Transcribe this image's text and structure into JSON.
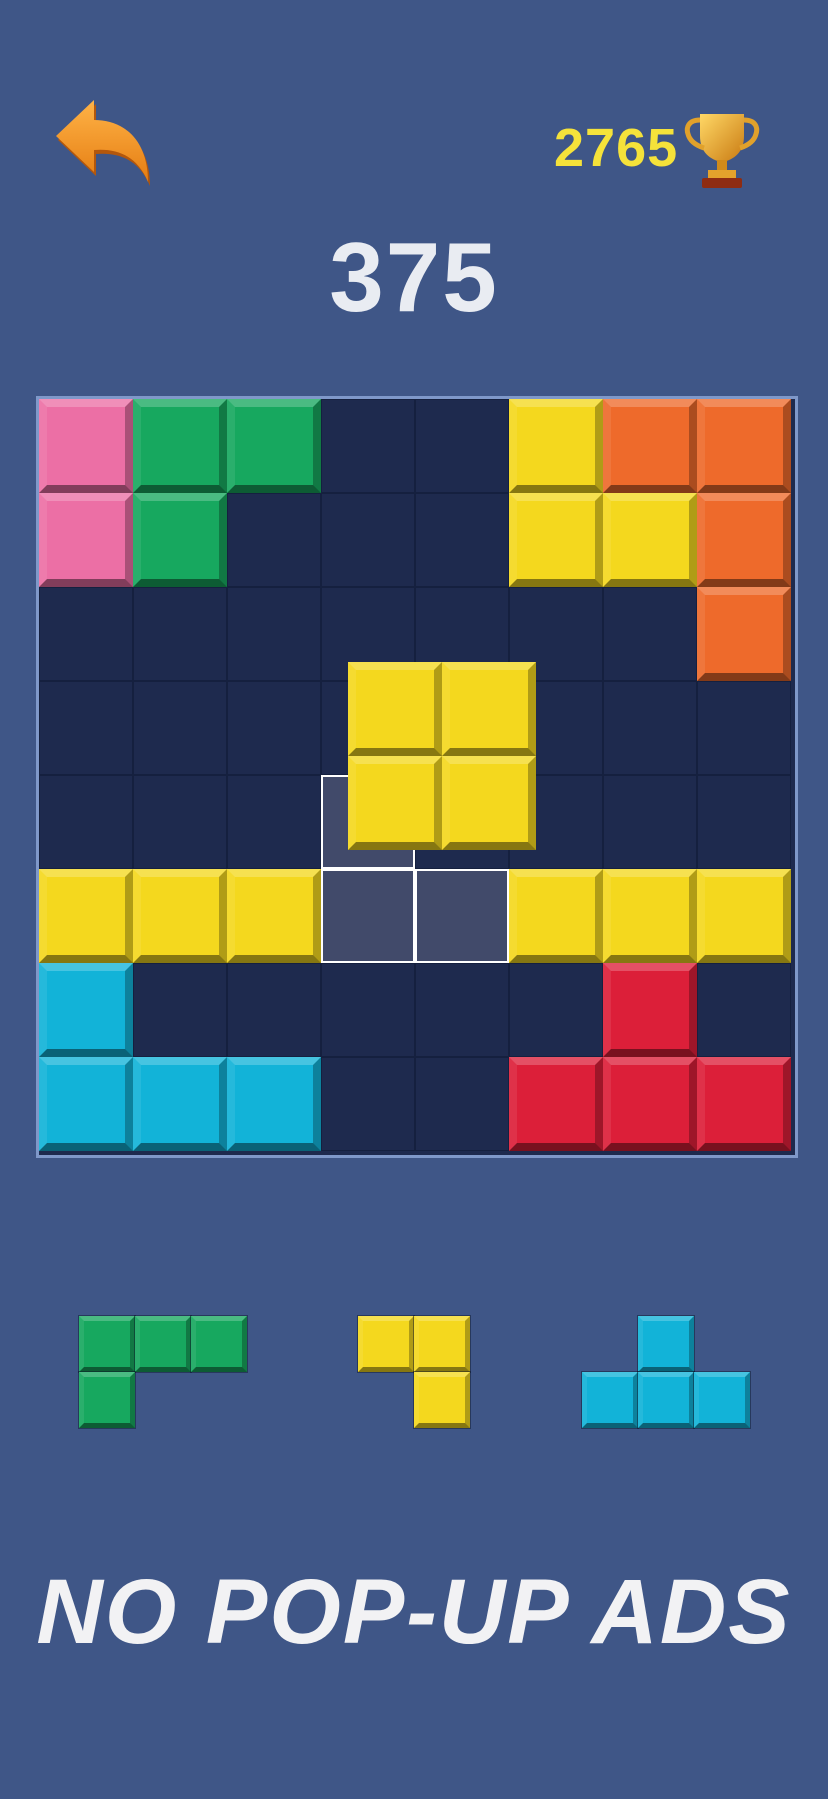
{
  "header": {
    "back_icon": "back-arrow-icon",
    "best_score": "2765",
    "best_icon": "trophy-icon",
    "score": "375"
  },
  "colors": {
    "background": "#3f5687",
    "board": "#1e2a4e",
    "pink": "#ec6fa5",
    "green": "#17a85f",
    "yellow": "#f4d81e",
    "orange": "#ee6a2b",
    "cyan": "#12b3d8",
    "red": "#dc1f39",
    "highlight": "#414a6a"
  },
  "board": {
    "rows": 8,
    "cols": 8,
    "cells": [
      [
        "pink",
        "green",
        "green",
        "",
        "",
        "yellow",
        "orange",
        "orange"
      ],
      [
        "pink",
        "green",
        "",
        "",
        "",
        "yellow",
        "yellow",
        "orange"
      ],
      [
        "",
        "",
        "",
        "",
        "",
        "",
        "",
        "orange"
      ],
      [
        "",
        "",
        "",
        "",
        "",
        "",
        "",
        ""
      ],
      [
        "",
        "",
        "",
        "",
        "",
        "",
        "",
        ""
      ],
      [
        "yellow",
        "yellow",
        "yellow",
        "",
        "",
        "yellow",
        "yellow",
        "yellow"
      ],
      [
        "cyan",
        "",
        "",
        "",
        "",
        "",
        "red",
        ""
      ],
      [
        "cyan",
        "cyan",
        "cyan",
        "",
        "",
        "red",
        "red",
        "red"
      ]
    ],
    "highlight_cells": [
      [
        4,
        3
      ],
      [
        5,
        3
      ],
      [
        5,
        4
      ]
    ]
  },
  "dragging_piece": {
    "color": "yellow",
    "shape": [
      [
        1,
        1
      ],
      [
        1,
        1
      ]
    ]
  },
  "tray": [
    {
      "color": "green",
      "shape": [
        [
          1,
          1,
          1
        ],
        [
          1,
          0,
          0
        ]
      ]
    },
    {
      "color": "yellow",
      "shape": [
        [
          1,
          1
        ],
        [
          0,
          1
        ]
      ]
    },
    {
      "color": "cyan",
      "shape": [
        [
          0,
          1,
          0
        ],
        [
          1,
          1,
          1
        ]
      ]
    }
  ],
  "promo_text": "NO POP-UP ADS"
}
